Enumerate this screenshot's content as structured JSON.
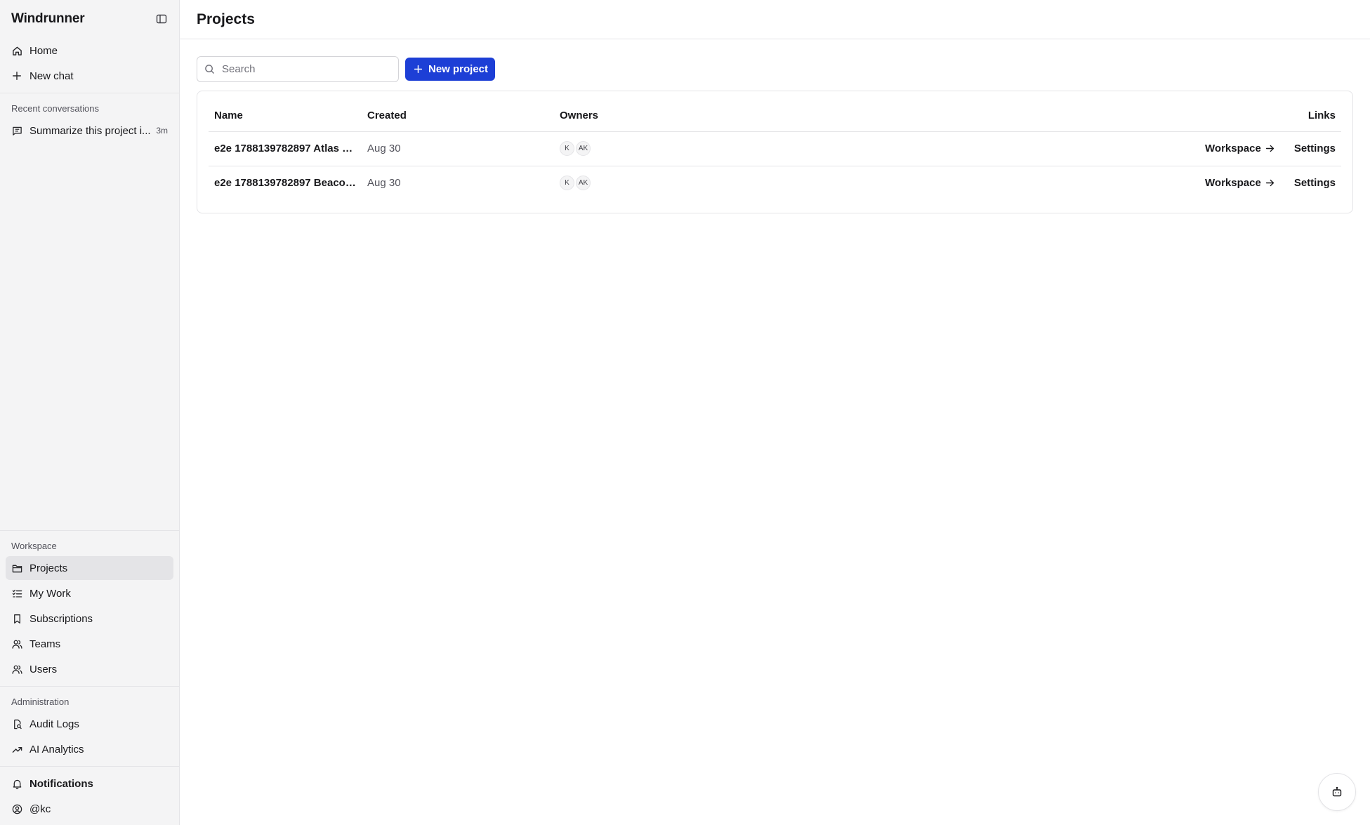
{
  "app": {
    "title": "Windrunner"
  },
  "sidebar": {
    "top_items": [
      {
        "label": "Home",
        "icon": "home-icon"
      },
      {
        "label": "New chat",
        "icon": "plus-icon"
      }
    ],
    "recent_label": "Recent conversations",
    "recent": [
      {
        "label": "Summarize this project i...",
        "time": "3m",
        "icon": "message-icon"
      }
    ],
    "workspace_label": "Workspace",
    "workspace_items": [
      {
        "label": "Projects",
        "icon": "folder-icon",
        "active": true
      },
      {
        "label": "My Work",
        "icon": "list-checks-icon"
      },
      {
        "label": "Subscriptions",
        "icon": "bookmark-icon"
      },
      {
        "label": "Teams",
        "icon": "users-icon"
      },
      {
        "label": "Users",
        "icon": "users-icon"
      }
    ],
    "admin_label": "Administration",
    "admin_items": [
      {
        "label": "Audit Logs",
        "icon": "file-search-icon"
      },
      {
        "label": "AI Analytics",
        "icon": "trending-up-icon"
      }
    ],
    "bottom_items": [
      {
        "label": "Notifications",
        "icon": "bell-icon"
      },
      {
        "label": "@kc",
        "icon": "user-circle-icon"
      }
    ]
  },
  "main": {
    "title": "Projects",
    "search": {
      "placeholder": "Search",
      "value": ""
    },
    "new_project_label": "New project",
    "table": {
      "columns": [
        "Name",
        "Created",
        "Owners",
        "Links"
      ],
      "rows": [
        {
          "name": "e2e 1788139782897 Atlas —...",
          "created": "Aug 30",
          "owners": [
            "K",
            "AK"
          ],
          "workspace_link": "Workspace",
          "settings_link": "Settings"
        },
        {
          "name": "e2e 1788139782897 Beacon...",
          "created": "Aug 30",
          "owners": [
            "K",
            "AK"
          ],
          "workspace_link": "Workspace",
          "settings_link": "Settings"
        }
      ]
    }
  },
  "colors": {
    "accent": "#1d3fd6",
    "sidebar_bg": "#f4f4f5",
    "border": "#e4e4e7"
  }
}
